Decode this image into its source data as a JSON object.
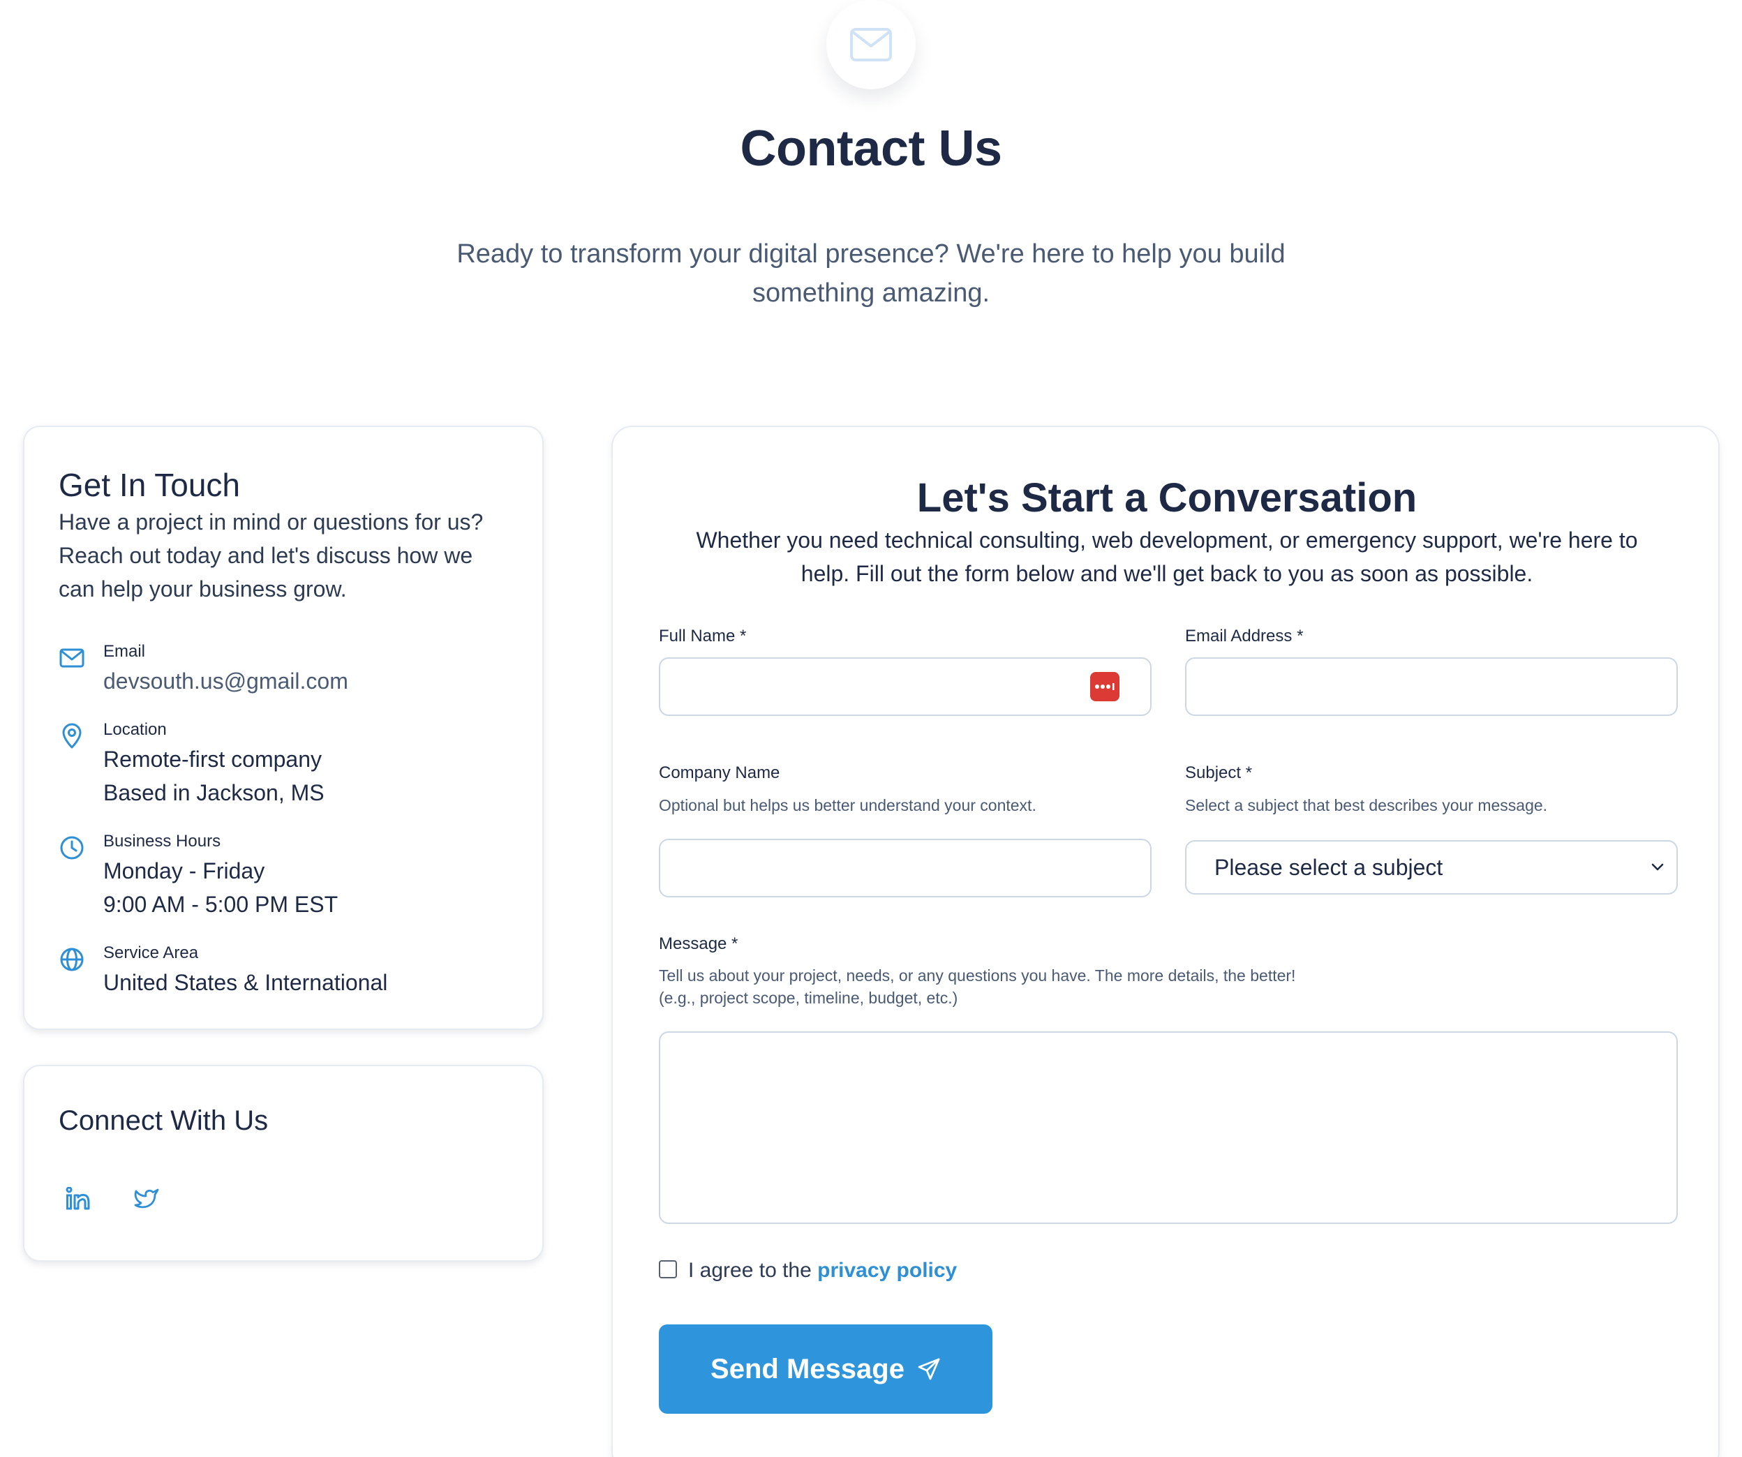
{
  "header": {
    "title": "Contact Us",
    "subtitle_line1": "Ready to transform your digital presence? We're here to help you build",
    "subtitle_line2": "something amazing.",
    "icon": "mail-icon"
  },
  "info": {
    "title": "Get In Touch",
    "desc_lines": [
      "Have a project in mind or questions for us?",
      "Reach out today and let's discuss how we",
      "can help your business grow."
    ],
    "items": [
      {
        "icon": "mail-icon",
        "label": "Email",
        "values": [
          "devsouth.us@gmail.com"
        ]
      },
      {
        "icon": "map-pin-icon",
        "label": "Location",
        "values": [
          "Remote-first company",
          "Based in Jackson, MS"
        ]
      },
      {
        "icon": "clock-icon",
        "label": "Business Hours",
        "values": [
          "Monday - Friday",
          "9:00 AM - 5:00 PM EST"
        ]
      },
      {
        "icon": "globe-icon",
        "label": "Service Area",
        "values": [
          "United States & International"
        ]
      }
    ]
  },
  "social": {
    "title": "Connect With Us",
    "links": [
      {
        "icon": "linkedin-icon"
      },
      {
        "icon": "twitter-icon"
      }
    ]
  },
  "form": {
    "title": "Let's Start a Conversation",
    "desc_line1": "Whether you need technical consulting, web development, or emergency support, we're here to",
    "desc_line2": "help. Fill out the form below and we'll get back to you as soon as possible.",
    "full_name": {
      "label": "Full Name *",
      "value": ""
    },
    "email": {
      "label": "Email Address *",
      "value": ""
    },
    "company": {
      "label": "Company Name",
      "help": "Optional but helps us better understand your context.",
      "value": ""
    },
    "subject": {
      "label": "Subject *",
      "help": "Select a subject that best describes your message.",
      "selected": "Please select a subject"
    },
    "message": {
      "label": "Message *",
      "help_line1": "Tell us about your project, needs, or any questions you have. The more details, the better!",
      "help_line2": "(e.g., project scope, timeline, budget, etc.)",
      "value": ""
    },
    "agree": {
      "text": "I agree to the ",
      "link": "privacy policy",
      "checked": false
    },
    "submit_label": "Send Message"
  },
  "colors": {
    "accent": "#2e95dc",
    "heading": "#1e2a45",
    "muted": "#4a5a73",
    "password_manager": "#dc3a34"
  }
}
